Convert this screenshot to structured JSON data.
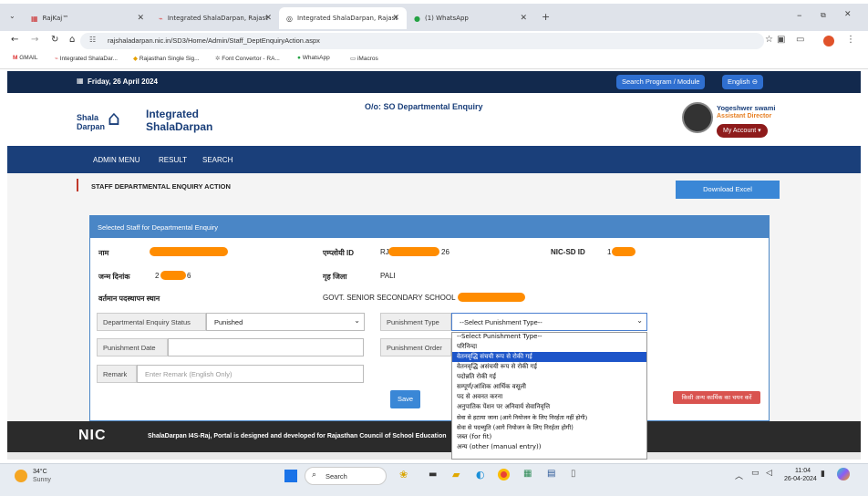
{
  "browser": {
    "tabs": [
      {
        "label": "RajKaj™"
      },
      {
        "label": "Integrated ShalaDarpan, Rajast"
      },
      {
        "label": "Integrated ShalaDarpan, Rajast"
      },
      {
        "label": "(1) WhatsApp"
      }
    ],
    "url": "rajshaladarpan.nic.in/SD3/Home/Admin/Staff_DeptEnquiryAction.aspx",
    "bookmarks": [
      "GMAIL",
      "Integrated ShalaDar...",
      "Rajasthan Single Sig...",
      "Font Convertor - RA...",
      "WhatsApp",
      "iMacros"
    ]
  },
  "site": {
    "date": "Friday, 26 April 2024",
    "search_program_label": "Search Program / Module",
    "language_label": "English",
    "logo_shala": "Shala",
    "logo_darpan": "Darpan",
    "brand_line1": "Integrated",
    "brand_line2": "ShalaDarpan",
    "office_title": "O/o: SO Departmental Enquiry",
    "user_name": "Yogeshwer swami",
    "user_role": "Assistant Director",
    "my_account_label": "My Account",
    "nav": [
      "ADMIN MENU",
      "RESULT",
      "SEARCH"
    ]
  },
  "page": {
    "heading": "STAFF DEPARTMENTAL ENQUIRY ACTION",
    "download_excel": "Download Excel",
    "panel_title": "Selected Staff for Departmental Enquiry",
    "labels": {
      "name": "नाम",
      "employee_id": "एम्प्लोयी ID",
      "nic_sd_id": "NIC-SD ID",
      "dob": "जन्म दिनांक",
      "home_district": "गृह जिला",
      "current_posting": "वर्तमान पदस्थापन स्थान"
    },
    "values": {
      "employee_id_prefix": "RJ",
      "employee_id_suffix": "26",
      "nic_sd_id_prefix": "1",
      "dob_prefix": "2",
      "dob_suffix": "6",
      "home_district": "PALI",
      "current_posting": "GOVT. SENIOR SECONDARY SCHOOL"
    },
    "form": {
      "enquiry_status_label": "Departmental Enquiry Status",
      "enquiry_status_value": "Punished",
      "punishment_type_label": "Punishment Type",
      "punishment_type_value": "--Select Punishment Type--",
      "punishment_date_label": "Punishment Date",
      "punishment_order_label": "Punishment Order",
      "remark_label": "Remark",
      "remark_placeholder": "Enter Remark (English Only)",
      "save_label": "Save",
      "other_action_label": "किसी अन्य कार्मिक का चयन करें"
    },
    "punishment_options": [
      "--Select Punishment Type--",
      "परिनिन्दा",
      "वेतनवृद्धि संचयी रूप से रोकी गई",
      "वेतनवृद्धि असंचयी रूप से रोकी गई",
      "पदोन्नति रोकी गई",
      "सम्पूर्ण/आंशिक आर्थिक वसूली",
      "पद से अवनत करना",
      "अनुपातिक पेंशन पर अनिवार्य सेवानिवृत्ति",
      "सेवा से हटाया जाना (आगे नियोजन के लिए निरर्हता नहीं होगी)",
      "सेवा से पदच्युति (आगे नियोजन के लिए निरर्हता होगी)",
      "जब्त (for fit)",
      "अन्य (other (manual entry))"
    ]
  },
  "footer": {
    "nic": "NIC",
    "text": "ShalaDarpan I4S-Raj, Portal is designed and developed for Rajasthan Council of School Education"
  },
  "taskbar": {
    "temperature": "34°C",
    "weather": "Sunny",
    "search_placeholder": "Search",
    "time": "11:04",
    "date": "26-04-2024"
  },
  "colors": {
    "navy": "#12294d",
    "nav_blue": "#1a3f7a",
    "panel_blue": "#4a86c6",
    "highlight": "#1d55c9",
    "redaction": "#ff8c00"
  }
}
